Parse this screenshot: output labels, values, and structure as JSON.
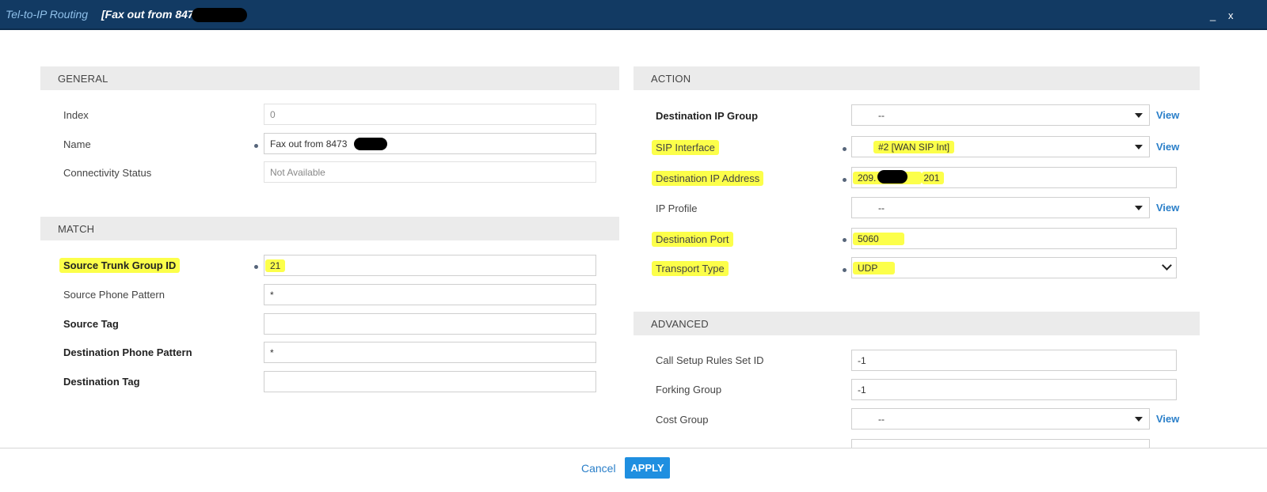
{
  "title": {
    "section": "Tel-to-IP Routing",
    "entity": "[Fax out from 8473"
  },
  "window_controls": {
    "minimize": "_",
    "close": "x"
  },
  "general": {
    "header": "GENERAL",
    "index_label": "Index",
    "index_value": "0",
    "name_label": "Name",
    "name_value": "Fax out from 8473",
    "connectivity_label": "Connectivity Status",
    "connectivity_value": "Not Available"
  },
  "match": {
    "header": "MATCH",
    "source_trunk_label": "Source Trunk Group ID",
    "source_trunk_value": "21",
    "source_phone_label": "Source Phone Pattern",
    "source_phone_value": "*",
    "source_tag_label": "Source Tag",
    "source_tag_value": "",
    "dest_phone_label": "Destination Phone Pattern",
    "dest_phone_value": "*",
    "dest_tag_label": "Destination Tag",
    "dest_tag_value": ""
  },
  "action": {
    "header": "ACTION",
    "dest_ip_group_label": "Destination IP Group",
    "dest_ip_group_value": "--",
    "sip_interface_label": "SIP Interface",
    "sip_interface_value": "#2 [WAN SIP Int]",
    "dest_ip_label": "Destination IP Address",
    "dest_ip_prefix": "209.",
    "dest_ip_suffix": "201",
    "ip_profile_label": "IP Profile",
    "ip_profile_value": "--",
    "dest_port_label": "Destination Port",
    "dest_port_value": "5060",
    "transport_label": "Transport Type",
    "transport_value": "UDP",
    "view_label": "View"
  },
  "advanced": {
    "header": "ADVANCED",
    "call_setup_label": "Call Setup Rules Set ID",
    "call_setup_value": "-1",
    "forking_label": "Forking Group",
    "forking_value": "-1",
    "cost_group_label": "Cost Group",
    "cost_group_value": "--"
  },
  "footer": {
    "cancel": "Cancel",
    "apply": "APPLY"
  }
}
